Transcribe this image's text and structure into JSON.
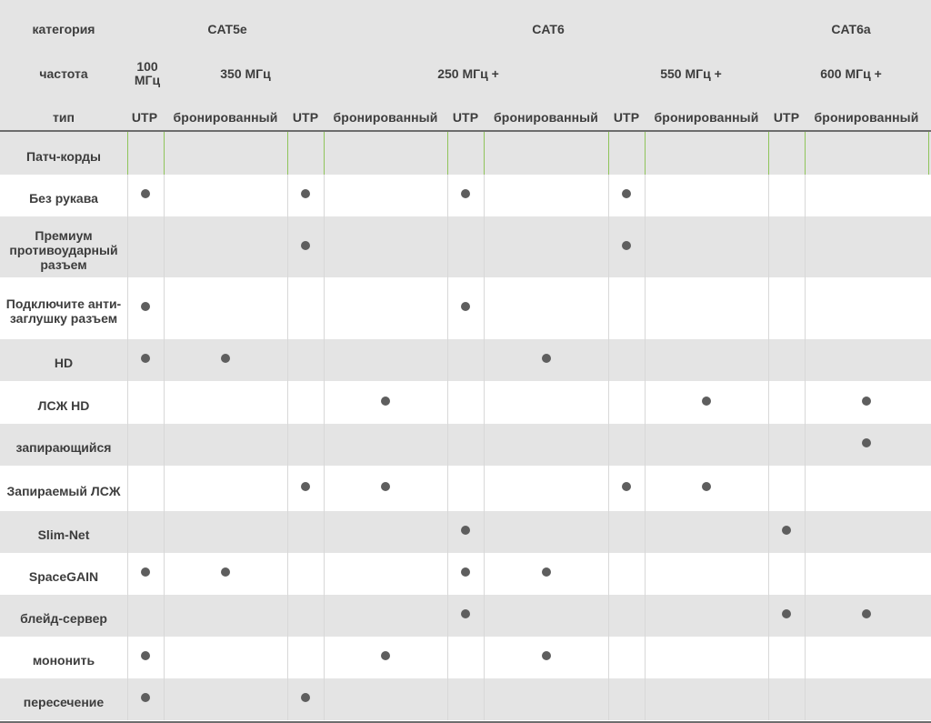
{
  "header": {
    "category_label": "категория",
    "frequency_label": "частота",
    "type_label": "тип",
    "categories": [
      "CAT5e",
      "CAT6",
      "CAT6a"
    ],
    "frequencies": [
      "100 МГц",
      "350 МГц",
      "250 МГц +",
      "550 МГц +",
      "600 МГц +"
    ],
    "types": [
      "UTP",
      "бронированный",
      "UTP",
      "бронированный",
      "UTP",
      "бронированный",
      "UTP",
      "бронированный",
      "UTP",
      "бронированный"
    ]
  },
  "rows": [
    {
      "label": "Патч-корды",
      "marks": [
        0,
        0,
        0,
        0,
        0,
        0,
        0,
        0,
        0,
        0
      ]
    },
    {
      "label": "Без рукава",
      "marks": [
        1,
        0,
        1,
        0,
        1,
        0,
        1,
        0,
        0,
        0
      ]
    },
    {
      "label": "Премиум противоударный разъем",
      "marks": [
        0,
        0,
        1,
        0,
        0,
        0,
        1,
        0,
        0,
        0
      ]
    },
    {
      "label": "Подключите анти-заглушку разъем",
      "marks": [
        1,
        0,
        0,
        0,
        1,
        0,
        0,
        0,
        0,
        0
      ]
    },
    {
      "label": "HD",
      "marks": [
        1,
        1,
        0,
        0,
        0,
        1,
        0,
        0,
        0,
        0
      ]
    },
    {
      "label": "ЛСЖ HD",
      "marks": [
        0,
        0,
        0,
        1,
        0,
        0,
        0,
        1,
        0,
        1
      ]
    },
    {
      "label": "запирающийся",
      "marks": [
        0,
        0,
        0,
        0,
        0,
        0,
        0,
        0,
        0,
        1
      ]
    },
    {
      "label": "Запираемый ЛСЖ",
      "marks": [
        0,
        0,
        1,
        1,
        0,
        0,
        1,
        1,
        0,
        0
      ]
    },
    {
      "label": "Slim-Net",
      "marks": [
        0,
        0,
        0,
        0,
        1,
        0,
        0,
        0,
        1,
        0
      ]
    },
    {
      "label": "SpaceGAIN",
      "marks": [
        1,
        1,
        0,
        0,
        1,
        1,
        0,
        0,
        0,
        0
      ]
    },
    {
      "label": "блейд-сервер",
      "marks": [
        0,
        0,
        0,
        0,
        1,
        0,
        0,
        0,
        1,
        1
      ]
    },
    {
      "label": "мононить",
      "marks": [
        1,
        0,
        0,
        1,
        0,
        1,
        0,
        0,
        0,
        0
      ]
    },
    {
      "label": "пересечение",
      "marks": [
        1,
        0,
        1,
        0,
        0,
        0,
        0,
        0,
        0,
        0
      ]
    }
  ],
  "colors": {
    "band": "#e4e4e4",
    "divider": "#6d6d6d",
    "accent_green": "#8fc45a",
    "dot": "#5e5e5e"
  }
}
